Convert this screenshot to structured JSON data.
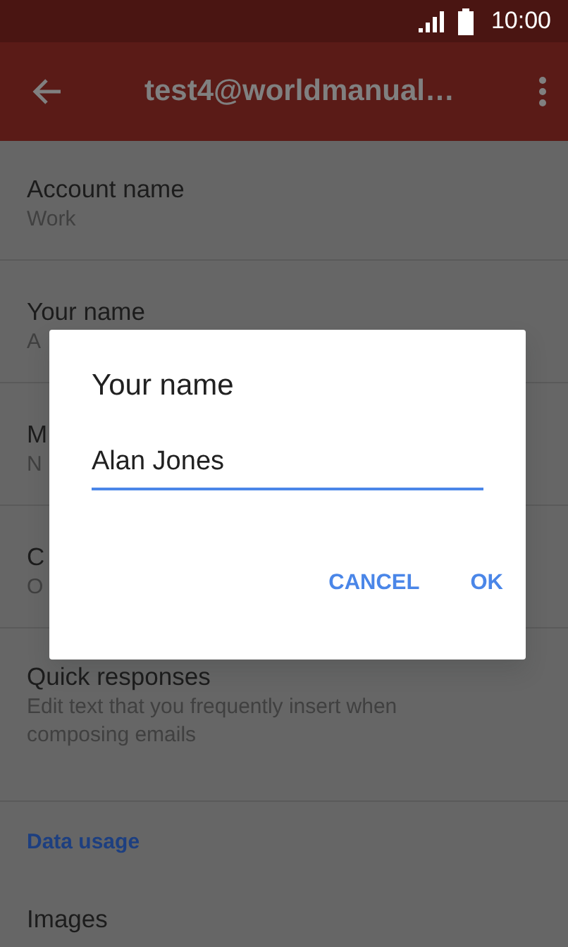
{
  "status_bar": {
    "time": "10:00"
  },
  "app_bar": {
    "title": "test4@worldmanual…"
  },
  "settings": [
    {
      "kind": "item",
      "title": "Account name",
      "summary": "Work"
    },
    {
      "kind": "item",
      "title": "Your name",
      "summary": "A"
    },
    {
      "kind": "item",
      "title": "M",
      "summary": "N"
    },
    {
      "kind": "item",
      "title": "C",
      "summary": "O"
    },
    {
      "kind": "item",
      "title": "Quick responses",
      "summary": "Edit text that you frequently insert when composing emails"
    },
    {
      "kind": "header",
      "title": "Data usage"
    },
    {
      "kind": "item",
      "title": "Images"
    }
  ],
  "dialog": {
    "title": "Your name",
    "value": "Alan Jones",
    "buttons": [
      "CANCEL",
      "OK"
    ]
  }
}
